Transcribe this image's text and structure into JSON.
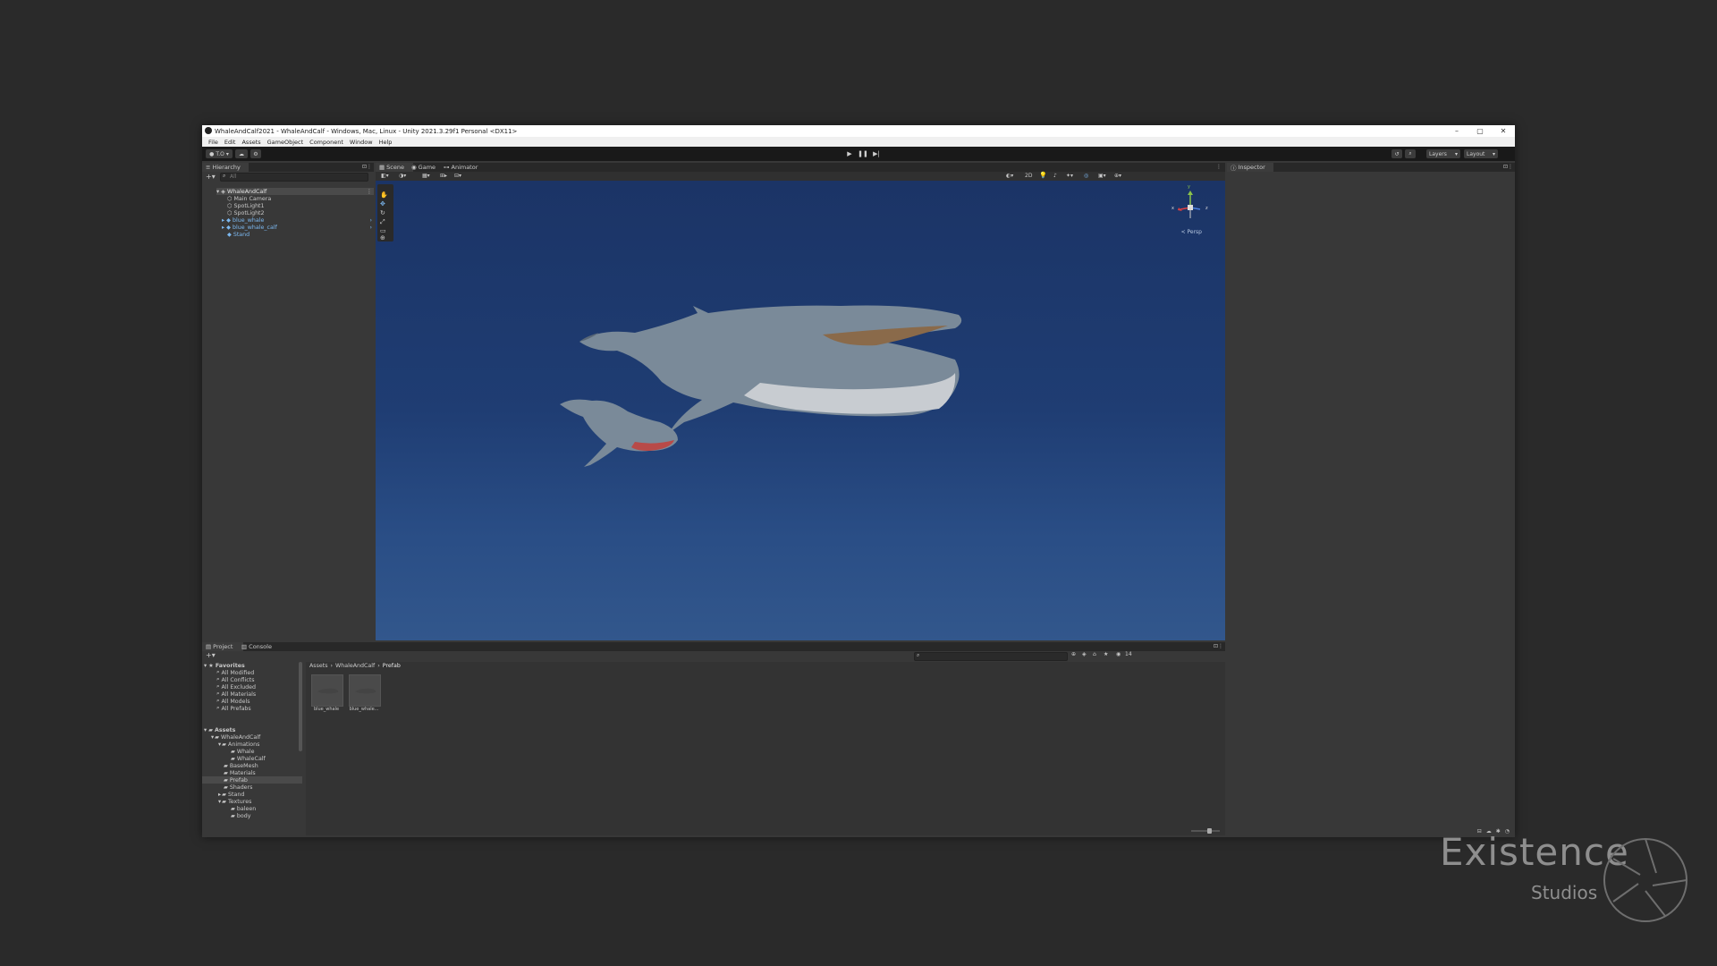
{
  "window": {
    "title": "WhaleAndCalf2021 - WhaleAndCalf - Windows, Mac, Linux - Unity 2021.3.29f1 Personal <DX11>",
    "controls": [
      "–",
      "▢",
      "✕"
    ]
  },
  "menu": [
    "File",
    "Edit",
    "Assets",
    "GameObject",
    "Component",
    "Window",
    "Help"
  ],
  "toolbar": {
    "account_label": "T.O",
    "layers_label": "Layers",
    "layout_label": "Layout"
  },
  "hierarchy": {
    "tab": "Hierarchy",
    "search_placeholder": "All",
    "scene": "WhaleAndCalf",
    "items": [
      "Main Camera",
      "SpotLight1",
      "SpotLight2",
      "blue_whale",
      "blue_whale_calf",
      "Stand"
    ]
  },
  "scene": {
    "tabs": [
      "Scene",
      "Game",
      "Animator"
    ],
    "toggle_2d": "2D",
    "persp_label": "< Persp",
    "gizmo_axes": [
      "y",
      "x",
      "z"
    ]
  },
  "inspector": {
    "tab": "Inspector"
  },
  "project": {
    "tabs": [
      "Project",
      "Console"
    ],
    "favorites_label": "Favorites",
    "favorites": [
      "All Modified",
      "All Conflicts",
      "All Excluded",
      "All Materials",
      "All Models",
      "All Prefabs"
    ],
    "assets_label": "Assets",
    "tree": [
      {
        "label": "WhaleAndCalf",
        "depth": 1
      },
      {
        "label": "Animations",
        "depth": 2
      },
      {
        "label": "Whale",
        "depth": 3
      },
      {
        "label": "WhaleCalf",
        "depth": 3
      },
      {
        "label": "BaseMesh",
        "depth": 2
      },
      {
        "label": "Materials",
        "depth": 2
      },
      {
        "label": "Prefab",
        "depth": 2,
        "selected": true
      },
      {
        "label": "Shaders",
        "depth": 2
      },
      {
        "label": "Stand",
        "depth": 2
      },
      {
        "label": "Textures",
        "depth": 2
      },
      {
        "label": "baleen",
        "depth": 3
      },
      {
        "label": "body",
        "depth": 3
      }
    ],
    "breadcrumb": [
      "Assets",
      "WhaleAndCalf",
      "Prefab"
    ],
    "assets": [
      "blue_whale",
      "blue_whale..."
    ],
    "hidden_count": "14"
  },
  "watermark": {
    "title": "Existence",
    "subtitle": "Studios"
  },
  "colors": {
    "prefab_blue": "#7cb8f0",
    "viewport_top": "#1b3466",
    "accent": "#3a72b0"
  }
}
